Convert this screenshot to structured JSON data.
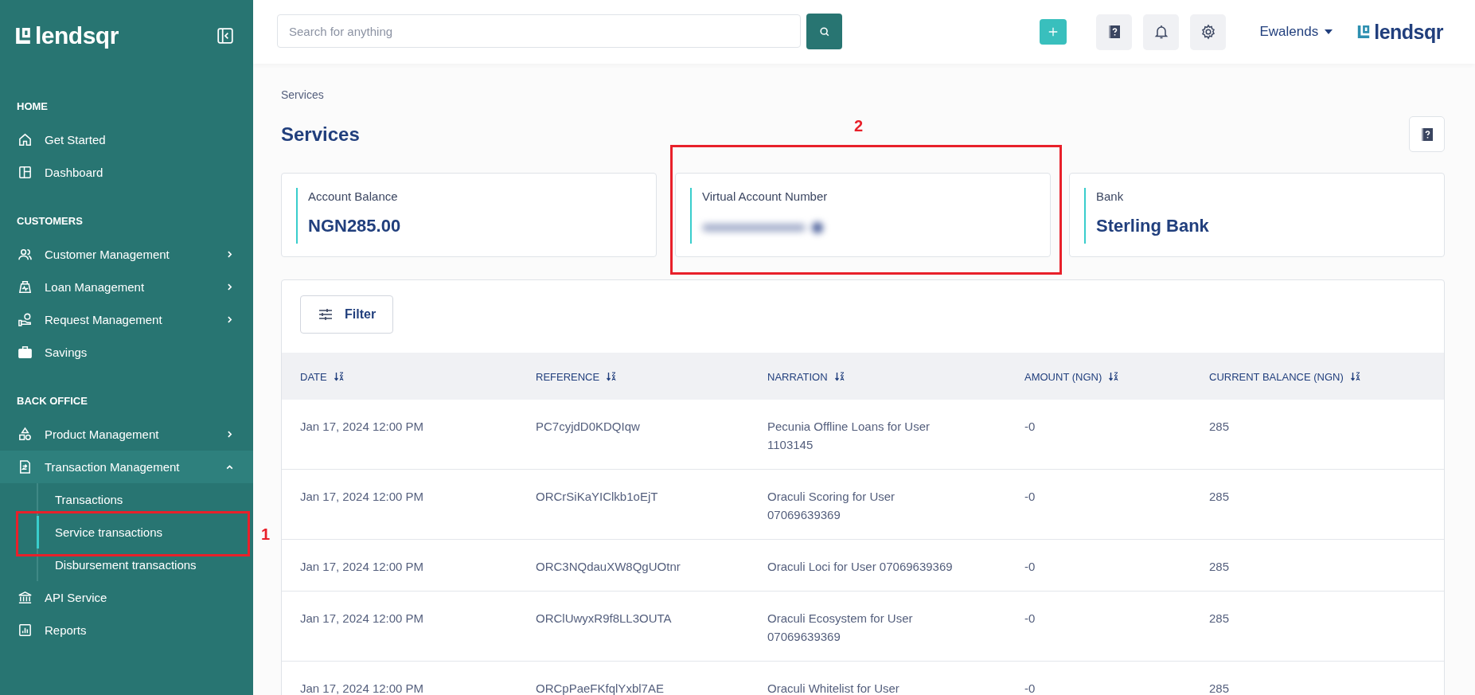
{
  "sidebar": {
    "brand": "lendsqr",
    "sections": [
      {
        "heading": "HOME",
        "items": [
          {
            "label": "Get Started"
          },
          {
            "label": "Dashboard"
          }
        ]
      },
      {
        "heading": "CUSTOMERS",
        "items": [
          {
            "label": "Customer Management",
            "expanded": false
          },
          {
            "label": "Loan Management",
            "expanded": false
          },
          {
            "label": "Request Management",
            "expanded": false
          },
          {
            "label": "Savings"
          }
        ]
      },
      {
        "heading": "BACK OFFICE",
        "items": [
          {
            "label": "Product Management",
            "expanded": false
          },
          {
            "label": "Transaction Management",
            "expanded": true,
            "children": [
              {
                "label": "Transactions",
                "selected": false
              },
              {
                "label": "Service transactions",
                "selected": true
              },
              {
                "label": "Disbursement transactions",
                "selected": false
              }
            ]
          },
          {
            "label": "API Service"
          },
          {
            "label": "Reports"
          }
        ]
      }
    ]
  },
  "header": {
    "search": {
      "placeholder": "Search for anything"
    },
    "user": "Ewalends",
    "brand": "lendsqr"
  },
  "breadcrumb": "Services",
  "title": "Services",
  "cards": [
    {
      "label": "Account Balance",
      "value": "NGN285.00",
      "redacted": false
    },
    {
      "label": "Virtual Account Number",
      "redacted": true
    },
    {
      "label": "Bank",
      "value": "Sterling Bank",
      "redacted": false
    }
  ],
  "filter_button": "Filter",
  "table": {
    "columns": [
      "DATE",
      "REFERENCE",
      "NARRATION",
      "AMOUNT (NGN)",
      "CURRENT BALANCE (NGN)"
    ],
    "rows": [
      [
        "Jan 17, 2024 12:00 PM",
        "PC7cyjdD0KDQIqw",
        "Pecunia Offline Loans for User 1103145",
        "-0",
        "285"
      ],
      [
        "Jan 17, 2024 12:00 PM",
        "ORCrSiKaYIClkb1oEjT",
        "Oraculi Scoring for User 07069639369",
        "-0",
        "285"
      ],
      [
        "Jan 17, 2024 12:00 PM",
        "ORC3NQdauXW8QgUOtnr",
        "Oraculi Loci for User 07069639369",
        "-0",
        "285"
      ],
      [
        "Jan 17, 2024 12:00 PM",
        "ORClUwyxR9f8LL3OUTA",
        "Oraculi Ecosystem for User 07069639369",
        "-0",
        "285"
      ],
      [
        "Jan 17, 2024 12:00 PM",
        "ORCpPaeFKfqlYxbl7AE",
        "Oraculi Whitelist for User",
        "-0",
        "285"
      ]
    ]
  },
  "annotations": [
    {
      "label": "1"
    },
    {
      "label": "2"
    }
  ]
}
